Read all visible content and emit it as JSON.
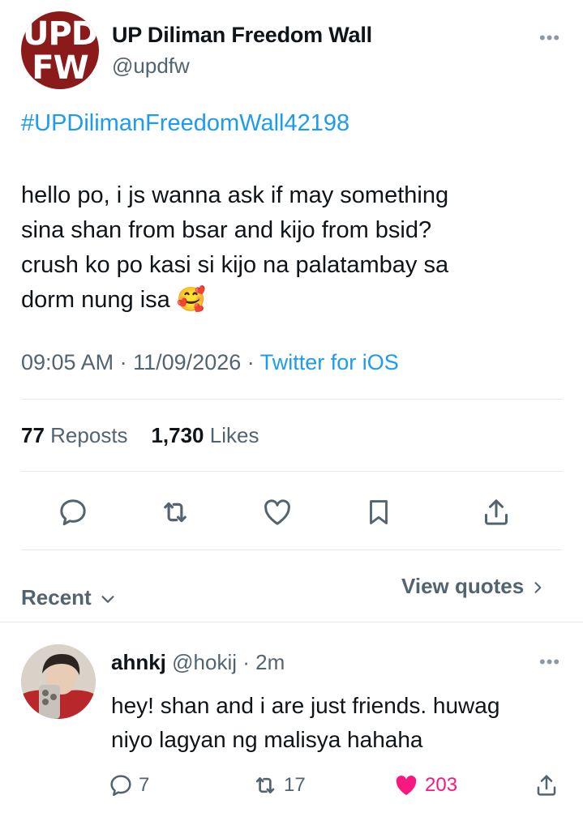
{
  "post": {
    "display_name": "UP Diliman Freedom Wall",
    "handle": "@updfw",
    "avatar_logo": [
      "UPD",
      "FW"
    ],
    "hashtag": "#UPDilimanFreedomWall42198",
    "body_lines": [
      "hello po, i js wanna ask if may something",
      "sina shan from bsar and kijo from bsid?",
      "crush ko po kasi si kijo na palatambay sa",
      "dorm nung isa"
    ],
    "emoji": "🥰",
    "time": "09:05 AM",
    "date": "11/09/2026",
    "separator": "·",
    "source": "Twitter for iOS",
    "more": "•••"
  },
  "stats": {
    "reposts_count": "77",
    "reposts_label": "Reposts",
    "likes_count": "1,730",
    "likes_label": "Likes"
  },
  "actions": [
    "reply-icon",
    "repost-icon",
    "like-icon",
    "bookmark-icon",
    "share-icon"
  ],
  "sort": {
    "recent_label": "Recent",
    "view_quotes_label": "View quotes"
  },
  "reply": {
    "display_name": "ahnkj",
    "handle": "@hokij",
    "separator": "·",
    "age": "2m",
    "more": "•••",
    "text_lines": [
      "hey! shan and i are just friends. huwag",
      "niyo lagyan ng malisya hahaha"
    ],
    "replies": "7",
    "reposts": "17",
    "likes": "203"
  },
  "colors": {
    "accent": "#1d9bf0",
    "like": "#f91880",
    "secondary_text": "#536471",
    "avatar_bg": "#8b1a1a"
  }
}
